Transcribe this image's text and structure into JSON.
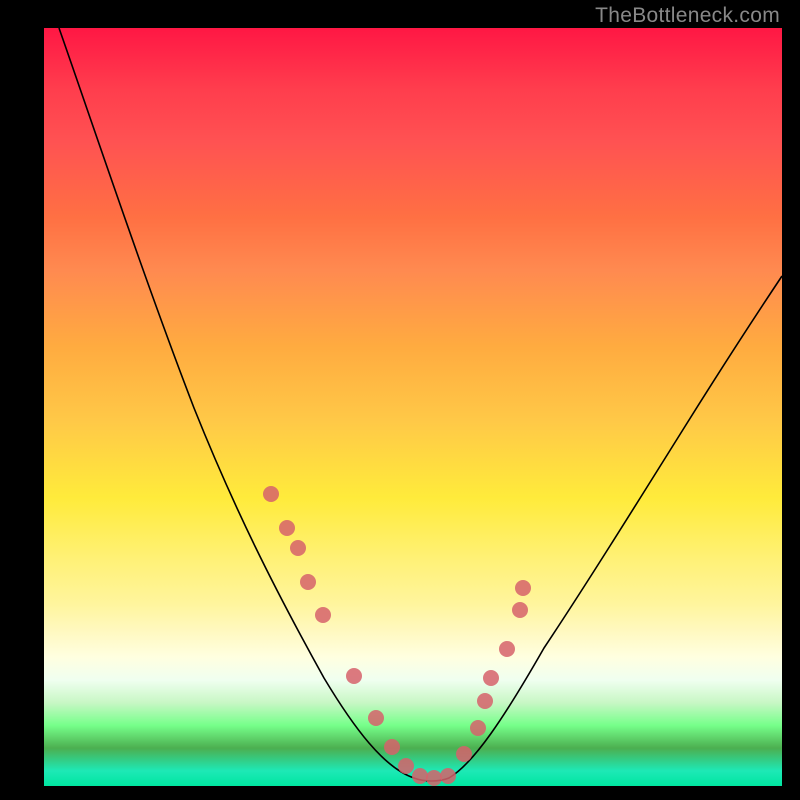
{
  "watermark": "TheBottleneck.com",
  "chart_data": {
    "type": "line",
    "title": "",
    "xlabel": "",
    "ylabel": "",
    "xlim": [
      0,
      100
    ],
    "ylim": [
      0,
      100
    ],
    "grid": false,
    "series": [
      {
        "name": "bottleneck-curve",
        "x": [
          2,
          8,
          14,
          20,
          26,
          30,
          34,
          38,
          42,
          46,
          48,
          50,
          52,
          54,
          58,
          62,
          66,
          70,
          76,
          82,
          88,
          94,
          100
        ],
        "y": [
          100,
          88,
          76,
          64,
          52,
          42,
          33,
          25,
          17,
          9,
          5,
          2,
          1,
          2,
          8,
          15,
          22,
          29,
          38,
          47,
          55,
          62,
          68
        ]
      }
    ],
    "markers": {
      "name": "highlight-points",
      "color": "#d6616b",
      "x": [
        31,
        33,
        36,
        38,
        42,
        45,
        47,
        49,
        50,
        52,
        53,
        55,
        57,
        59,
        60,
        62,
        65
      ],
      "y": [
        38,
        33,
        27,
        22,
        14,
        8,
        4,
        2,
        1,
        1,
        2,
        4,
        7,
        11,
        14,
        17,
        23
      ]
    },
    "gradient": {
      "stops": [
        {
          "pos": 0,
          "color": "#ff1744"
        },
        {
          "pos": 50,
          "color": "#ffeb3b"
        },
        {
          "pos": 100,
          "color": "#00e676"
        }
      ]
    }
  }
}
